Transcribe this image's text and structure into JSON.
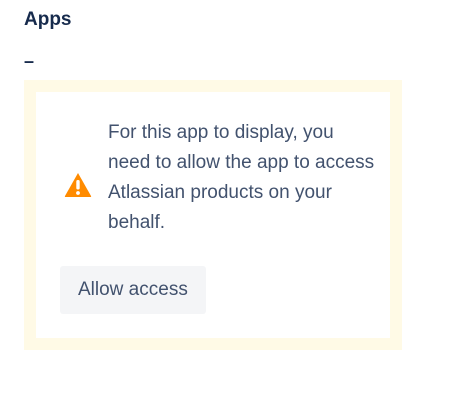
{
  "section": {
    "title": "Apps",
    "dash": "–"
  },
  "notice": {
    "message": "For this app to display, you need to allow the app to access Atlassian products on your behalf.",
    "icon": "warning-icon",
    "button_label": "Allow access"
  },
  "colors": {
    "title": "#172b4d",
    "frame_background": "#fffae6",
    "warning": "#ff8b00",
    "button_background": "#f4f5f7",
    "text": "#42526e"
  }
}
